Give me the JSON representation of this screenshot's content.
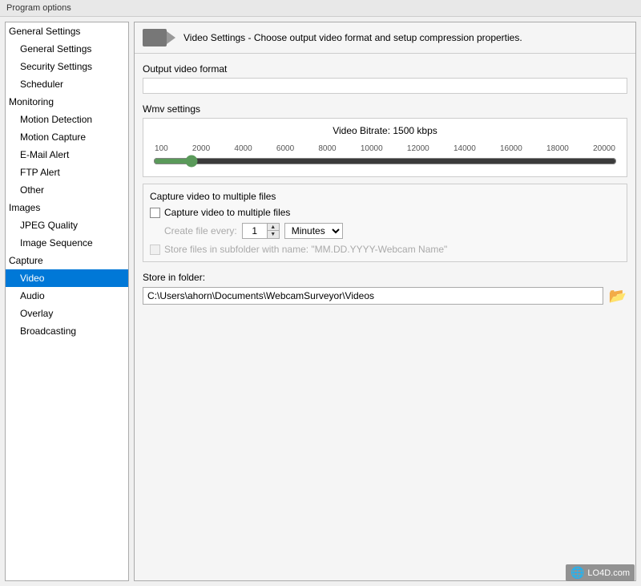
{
  "window": {
    "title": "Program options"
  },
  "sidebar": {
    "groups": [
      {
        "label": "General Settings",
        "children": [
          {
            "label": "General Settings",
            "selected": false
          },
          {
            "label": "Security Settings",
            "selected": false
          },
          {
            "label": "Scheduler",
            "selected": false
          }
        ]
      },
      {
        "label": "Monitoring",
        "children": [
          {
            "label": "Motion Detection",
            "selected": false
          },
          {
            "label": "Motion Capture",
            "selected": false
          },
          {
            "label": "E-Mail Alert",
            "selected": false
          },
          {
            "label": "FTP Alert",
            "selected": false
          },
          {
            "label": "Other",
            "selected": false
          }
        ]
      },
      {
        "label": "Images",
        "children": [
          {
            "label": "JPEG Quality",
            "selected": false
          },
          {
            "label": "Image Sequence",
            "selected": false
          }
        ]
      },
      {
        "label": "Capture",
        "children": [
          {
            "label": "Video",
            "selected": true
          },
          {
            "label": "Audio",
            "selected": false
          },
          {
            "label": "Overlay",
            "selected": false
          },
          {
            "label": "Broadcasting",
            "selected": false
          }
        ]
      }
    ]
  },
  "main": {
    "header_text": "Video Settings - Choose output video format and setup compression properties.",
    "output_video_format_label": "Output video format",
    "wmv_settings_label": "Wmv settings",
    "bitrate_label": "Video Bitrate:  1500 kbps",
    "slider": {
      "min": 100,
      "max": 20000,
      "value": 1500,
      "ticks": [
        "100",
        "2000",
        "4000",
        "6000",
        "8000",
        "10000",
        "12000",
        "14000",
        "16000",
        "18000",
        "20000"
      ]
    },
    "capture_section": {
      "title": "Capture video to multiple files",
      "checkbox_label": "Capture video to multiple files",
      "create_file_label": "Create file every:",
      "create_file_value": "1",
      "create_file_unit": "Minutes",
      "subfolder_label": "Store files in subfolder with name: \"MM.DD.YYYY-Webcam Name\"",
      "subfolder_checked": false,
      "checkbox_checked": false
    },
    "store_folder": {
      "label": "Store in folder:",
      "path": "C:\\Users\\ahorn\\Documents\\WebcamSurveyor\\Videos"
    }
  },
  "watermark": {
    "text": "LO4D.com"
  }
}
